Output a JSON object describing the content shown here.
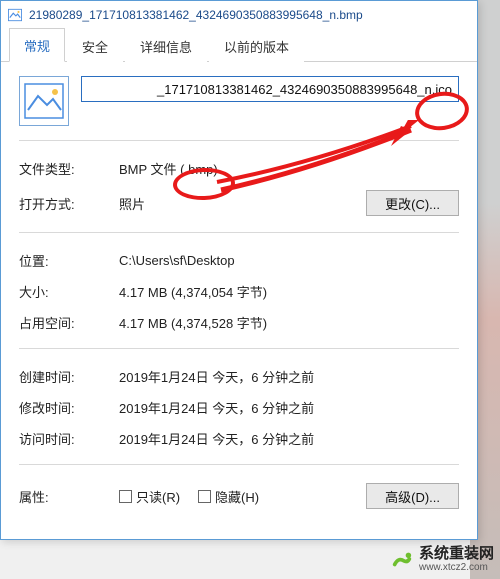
{
  "title": "21980289_171710813381462_4324690350883995648_n.bmp",
  "tabs": [
    {
      "label": "常规",
      "active": true
    },
    {
      "label": "安全",
      "active": false
    },
    {
      "label": "详细信息",
      "active": false
    },
    {
      "label": "以前的版本",
      "active": false
    }
  ],
  "filename_value": "_171710813381462_4324690350883995648_n.ico",
  "rows": {
    "file_type_label": "文件类型:",
    "file_type_value": "BMP 文件 (.bmp)",
    "opens_with_label": "打开方式:",
    "opens_with_value": "照片",
    "change_button": "更改(C)...",
    "location_label": "位置:",
    "location_value": "C:\\Users\\sf\\Desktop",
    "size_label": "大小:",
    "size_value": "4.17 MB (4,374,054 字节)",
    "size_on_disk_label": "占用空间:",
    "size_on_disk_value": "4.17 MB (4,374,528 字节)",
    "created_label": "创建时间:",
    "created_value": "2019年1月24日 今天，6 分钟之前",
    "modified_label": "修改时间:",
    "modified_value": "2019年1月24日 今天，6 分钟之前",
    "accessed_label": "访问时间:",
    "accessed_value": "2019年1月24日 今天，6 分钟之前",
    "attributes_label": "属性:",
    "readonly_label": "只读(R)",
    "hidden_label": "隐藏(H)",
    "advanced_button": "高级(D)..."
  },
  "watermark": {
    "title": "系统重装网",
    "url": "www.xtcz2.com"
  },
  "colors": {
    "accent": "#2a6ec0",
    "annotation": "#e81a1a"
  }
}
